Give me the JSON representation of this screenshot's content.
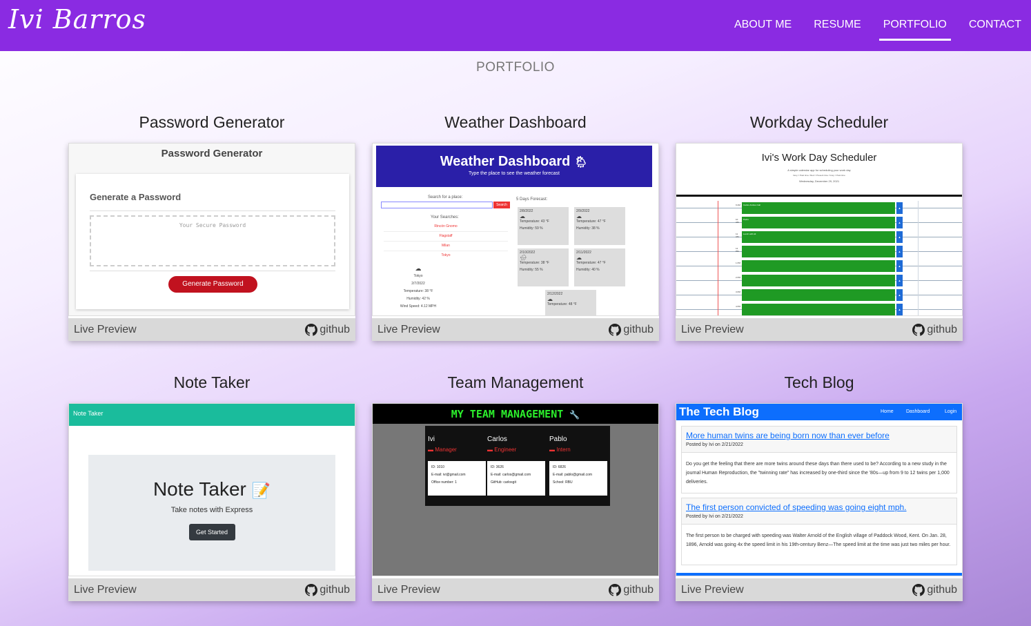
{
  "nav": {
    "brand": "Ivi Barros",
    "links": [
      "ABOUT ME",
      "RESUME",
      "PORTFOLIO",
      "CONTACT"
    ]
  },
  "page_heading": "PORTFOLIO",
  "footer": {
    "live": "Live Preview",
    "github": "github"
  },
  "projects": [
    {
      "title": "Password Generator"
    },
    {
      "title": "Weather Dashboard"
    },
    {
      "title": "Workday Scheduler"
    },
    {
      "title": "Note Taker"
    },
    {
      "title": "Team Management"
    },
    {
      "title": "Tech Blog"
    }
  ],
  "pw": {
    "header": "Password Generator",
    "card_title": "Generate a Password",
    "placeholder": "Your Secure Password",
    "button": "Generate Password"
  },
  "weather": {
    "title": "Weather Dashboard",
    "subtitle": "Type the place to see the weather forecast",
    "search_label": "Search for a place:",
    "search_button": "Search",
    "your_searches": "Your Searches:",
    "searches": [
      "Rincón Gnomo",
      "Flagstaff",
      "Milan",
      "Tokyo"
    ],
    "forecast_label": "5 Days Forecast:",
    "days": [
      "2/8/2022",
      "2/9/2022",
      "2/10/2022",
      "2/11/2022",
      "2/12/2022"
    ],
    "temps": [
      "Temperature: 43 °F",
      "Temperature: 47 °F",
      "Temperature: 38 °F",
      "Temperature: 47 °F",
      "Temperature: 48 °F"
    ],
    "hums": [
      "Humidity: 59 %",
      "Humidity: 38 %",
      "Humidity: 55 %",
      "Humidity: 40 %"
    ],
    "current": [
      "Tokyo",
      "2/7/2022",
      "Temperature: 38 °F",
      "Humidity: 42 %",
      "Wind Speed: 4.12 MPH"
    ]
  },
  "scheduler": {
    "title": "Ivi's Work Day Scheduler",
    "subtitle": "A simple calendar app for scheduling your work day",
    "legend": "Grey = Past time / Red = Present time / Grey = Past time",
    "date": "Wednesday, December 29, 2021",
    "hours": [
      "9 AM",
      "10 AM",
      "11 AM",
      "12 PM",
      "1 PM",
      "2 PM",
      "3 PM",
      "4 PM"
    ],
    "notes": [
      "Carlos Andres Call",
      "Pedro",
      "Lunch with Ali",
      "",
      "",
      "",
      "",
      ""
    ]
  },
  "note": {
    "bar": "Note Taker",
    "title": "Note Taker",
    "subtitle": "Take notes with Express",
    "button": "Get Started"
  },
  "team": {
    "title": "MY TEAM MANAGEMENT",
    "members": [
      {
        "name": "Ivi",
        "role": "Manager",
        "id": "ID: 1010",
        "line2": "E-mail: ivi@gmail.com",
        "line3": "Office number: 1"
      },
      {
        "name": "Carlos",
        "role": "Engineer",
        "id": "ID: 3626",
        "line2": "E-mail: carlos@gmail.com",
        "line3": "GitHub: carlosgit"
      },
      {
        "name": "Pablo",
        "role": "Intern",
        "id": "ID: 6826",
        "line2": "E-mail: pablo@gmail.com",
        "line3": "School: RBU"
      }
    ]
  },
  "blog": {
    "title": "The Tech Blog",
    "links": [
      "Home",
      "Dashboard",
      "Login"
    ],
    "posts": [
      {
        "title": "More human twins are being born now than ever before",
        "meta": "Posted by Ivi on 2/21/2022",
        "body": "Do you get the feeling that there are more twins around these days than there used to be? According to a new study in the journal Human Reproduction, the \"twinning rate\" has increased by one-third since the '80s—up from 9 to 12 twins per 1,000 deliveries."
      },
      {
        "title": "The first person convicted of speeding was going eight mph.",
        "meta": "Posted by Ivi on 2/21/2022",
        "body": "The first person to be charged with speeding was Walter Arnold of the English village of Paddock Wood, Kent. On Jan. 28, 1896, Arnold was going 4x the speed limit in his 19th-century Benz—The speed limit at the time was just two miles per hour."
      }
    ]
  }
}
